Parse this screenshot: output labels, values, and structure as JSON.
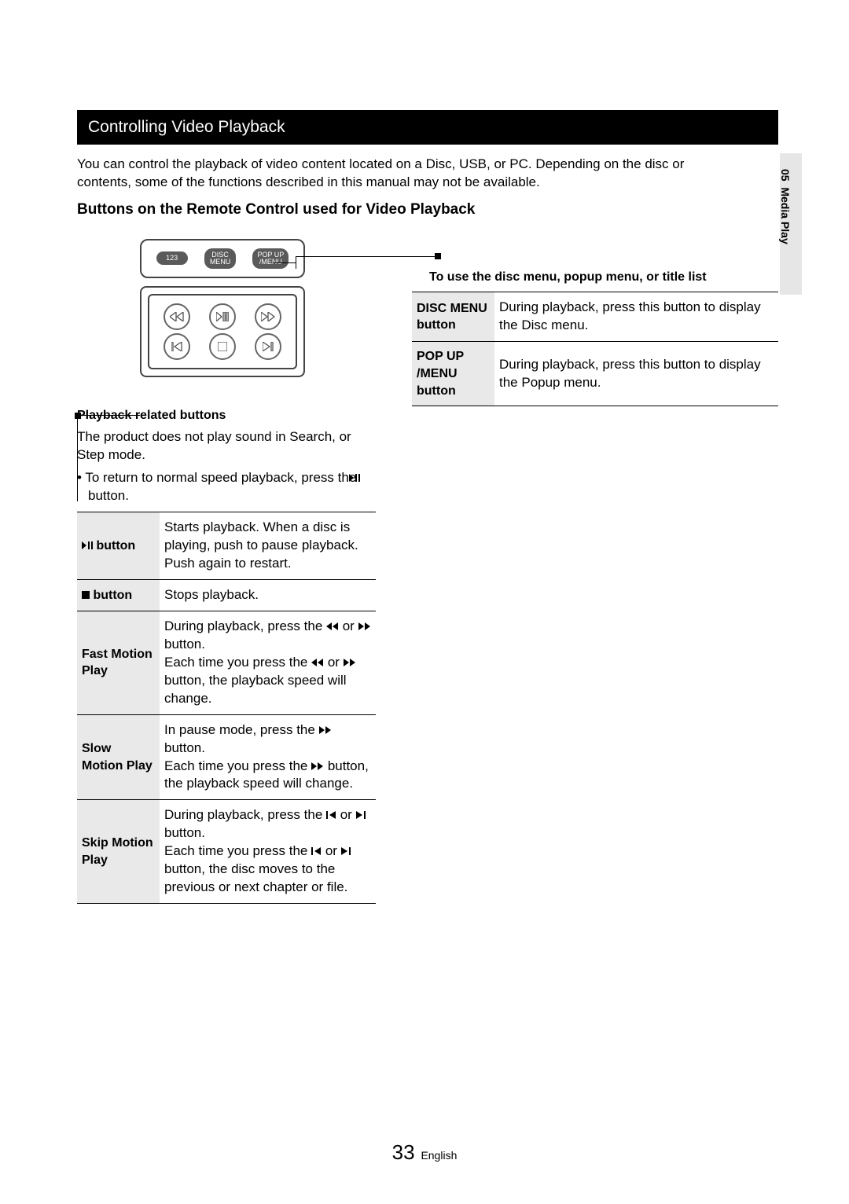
{
  "side": {
    "chapter": "05",
    "name": "Media Play"
  },
  "section_header": "Controlling Video Playback",
  "intro": "You can control the playback of video content located on a Disc, USB, or PC. Depending on the disc or contents, some of the functions described in this manual may not be available.",
  "subhead": "Buttons on the Remote Control used for Video Playback",
  "remote": {
    "btn_123": "123",
    "btn_disc_l1": "DISC",
    "btn_disc_l2": "MENU",
    "btn_pop_l1": "POP UP",
    "btn_pop_l2": "/MENU"
  },
  "left": {
    "title": "Playback related buttons",
    "note": "The product does not play sound in Search, or Step mode.",
    "bullet_pre": "To return to normal speed playback, press the ",
    "bullet_post": " button.",
    "rows": [
      {
        "k_pre": "",
        "k_post": " button",
        "v": "Starts playback. When a disc is playing, push to pause playback. Push again to restart."
      },
      {
        "k_pre": "",
        "k_post": " button",
        "v": "Stops playback."
      },
      {
        "k": "Fast Motion Play",
        "v1": "During playback, press the ",
        "v2": " or ",
        "v3": " button.",
        "v4": "Each time you press the ",
        "v5": " or ",
        "v6": " button, the playback speed will change."
      },
      {
        "k": "Slow Motion Play",
        "v1": "In pause mode, press the ",
        "v2": " button.",
        "v3": "Each time you press the ",
        "v4": " button, the playback speed will change."
      },
      {
        "k": "Skip Motion Play",
        "v1": "During playback, press the ",
        "v2": " or ",
        "v3": " button.",
        "v4": "Each time you press the ",
        "v5": " or ",
        "v6": " button, the disc moves to the previous or next chapter or file."
      }
    ]
  },
  "right": {
    "title": "To use the disc menu, popup menu, or title list",
    "rows": [
      {
        "k": "DISC MENU button",
        "v": "During playback, press this button to display the Disc menu."
      },
      {
        "k": "POP UP /MENU button",
        "v": "During playback, press this button to display the Popup menu."
      }
    ]
  },
  "footer": {
    "page": "33",
    "lang": "English"
  }
}
